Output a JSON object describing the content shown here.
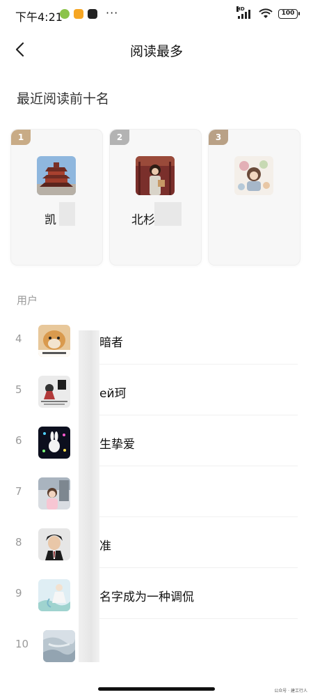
{
  "status_bar": {
    "time": "下午4:21",
    "more": "···",
    "hd": "HD",
    "battery": "100"
  },
  "header": {
    "title": "阅读最多"
  },
  "top_section": {
    "title": "最近阅读前十名",
    "cards": [
      {
        "rank": "1",
        "name": "凯",
        "badge_color": "#c8ab86"
      },
      {
        "rank": "2",
        "name": "北杉",
        "badge_color": "#b3b3b3"
      },
      {
        "rank": "3",
        "name": "",
        "badge_color": "#b9a186"
      }
    ]
  },
  "user_list": {
    "label": "用户",
    "rows": [
      {
        "rank": "4",
        "name": "暗者"
      },
      {
        "rank": "5",
        "name": "ей珂"
      },
      {
        "rank": "6",
        "name": "生挚爱"
      },
      {
        "rank": "7",
        "name": ""
      },
      {
        "rank": "8",
        "name": "准"
      },
      {
        "rank": "9",
        "name": "名字成为一种调侃"
      },
      {
        "rank": "10",
        "name": ""
      }
    ]
  },
  "watermark": "公众号 · 建工行人"
}
